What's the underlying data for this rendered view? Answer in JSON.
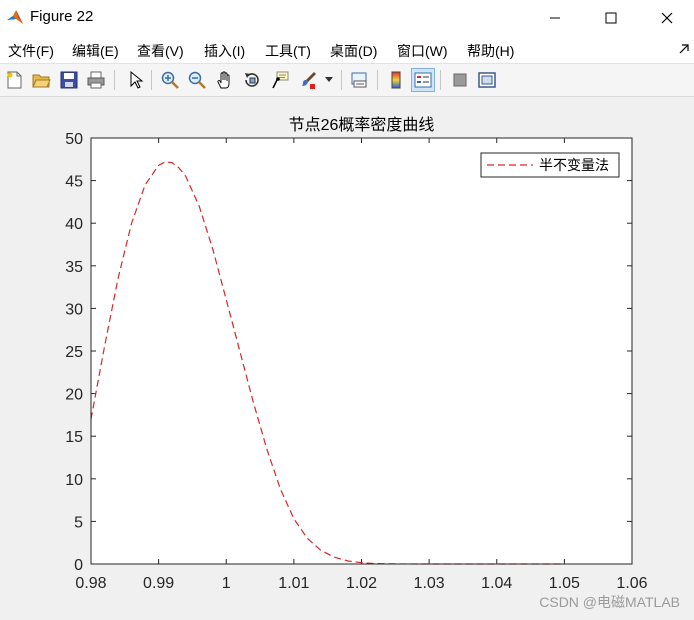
{
  "window": {
    "title": "Figure 22"
  },
  "menu": {
    "items": [
      "文件(F)",
      "编辑(E)",
      "查看(V)",
      "插入(I)",
      "工具(T)",
      "桌面(D)",
      "窗口(W)",
      "帮助(H)"
    ]
  },
  "toolbar": {
    "buttons": [
      {
        "name": "new-figure-icon"
      },
      {
        "name": "open-file-icon"
      },
      {
        "name": "save-icon"
      },
      {
        "name": "print-icon"
      },
      {
        "name": "pointer-icon"
      },
      {
        "name": "zoom-in-icon"
      },
      {
        "name": "zoom-out-icon"
      },
      {
        "name": "pan-icon"
      },
      {
        "name": "rotate-3d-icon"
      },
      {
        "name": "data-cursor-icon"
      },
      {
        "name": "brush-icon"
      },
      {
        "name": "link-plot-icon"
      },
      {
        "name": "colorbar-icon"
      },
      {
        "name": "legend-icon",
        "active": true
      },
      {
        "name": "hide-plot-tools-icon"
      },
      {
        "name": "show-plot-tools-icon"
      }
    ]
  },
  "chart_data": {
    "type": "line",
    "title": "节点26概率密度曲线",
    "xlabel": "",
    "ylabel": "",
    "xlim": [
      0.98,
      1.06
    ],
    "ylim": [
      0,
      50
    ],
    "xticks": [
      "0.98",
      "0.99",
      "1",
      "1.01",
      "1.02",
      "1.03",
      "1.04",
      "1.05",
      "1.06"
    ],
    "yticks": [
      "0",
      "5",
      "10",
      "15",
      "20",
      "25",
      "30",
      "35",
      "40",
      "45",
      "50"
    ],
    "legend_position": "top-right",
    "grid": false,
    "series": [
      {
        "name": "半不变量法",
        "color": "#d62728",
        "style": "dashed",
        "x": [
          0.98,
          0.982,
          0.984,
          0.986,
          0.988,
          0.99,
          0.991,
          0.992,
          0.993,
          0.994,
          0.996,
          0.998,
          1.0,
          1.002,
          1.004,
          1.006,
          1.008,
          1.01,
          1.012,
          1.014,
          1.016,
          1.018,
          1.02,
          1.022,
          1.025,
          1.03,
          1.04,
          1.05
        ],
        "y": [
          17,
          25.5,
          33.5,
          40,
          44.5,
          46.8,
          47.2,
          47.1,
          46.5,
          45.5,
          42,
          37,
          31,
          25,
          19,
          13.5,
          8.8,
          5.3,
          3.0,
          1.6,
          0.8,
          0.35,
          0.15,
          0.05,
          0.01,
          0,
          0,
          0
        ]
      }
    ]
  },
  "watermark": {
    "text": "CSDN @电磁MATLAB"
  }
}
